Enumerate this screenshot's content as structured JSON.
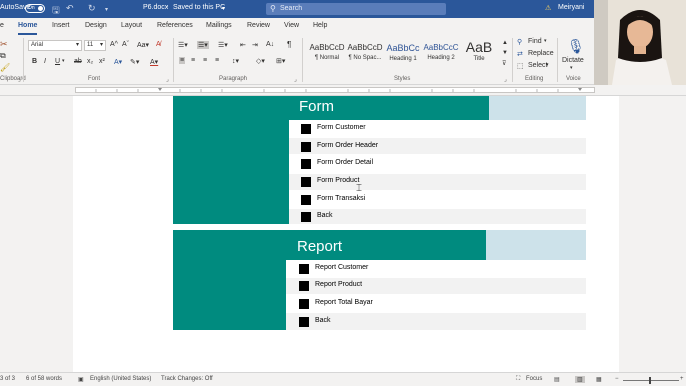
{
  "titlebar": {
    "autosave": "AutoSave",
    "toggle": "On",
    "doc_title": "P6.docx",
    "saved": "Saved to this PC",
    "search_placeholder": "Search",
    "user": "Meiryani"
  },
  "tabs": [
    "Home",
    "Insert",
    "Design",
    "Layout",
    "References",
    "Mailings",
    "Review",
    "View",
    "Help"
  ],
  "ribbon": {
    "font_name": "Arial",
    "font_size": "11",
    "groups": {
      "clipboard": "Clipboard",
      "font": "Font",
      "paragraph": "Paragraph",
      "styles": "Styles",
      "editing": "Editing",
      "voice": "Voice"
    },
    "styles": [
      {
        "sample": "AaBbCcD",
        "label": "¶ Normal"
      },
      {
        "sample": "AaBbCcD",
        "label": "¶ No Spac..."
      },
      {
        "sample": "AaBbCc",
        "label": "Heading 1"
      },
      {
        "sample": "AaBbCcC",
        "label": "Heading 2"
      },
      {
        "sample": "AaB",
        "label": "Title"
      }
    ],
    "editing": {
      "find": "Find",
      "replace": "Replace",
      "select": "Select"
    },
    "dictate": "Dictate"
  },
  "document": {
    "form_title": "Form",
    "form_items": [
      "Form Customer",
      "Form Order Header",
      "Form Order Detail",
      "Form Product",
      "Form Transaksi",
      "Back"
    ],
    "report_title": "Report",
    "report_items": [
      "Report Customer",
      "Report Product",
      "Report Total Bayar",
      "Back"
    ]
  },
  "status": {
    "page": "3 of 3",
    "words": "6 of 58 words",
    "language": "English (United States)",
    "track": "Track Changes: Off",
    "focus": "Focus"
  }
}
